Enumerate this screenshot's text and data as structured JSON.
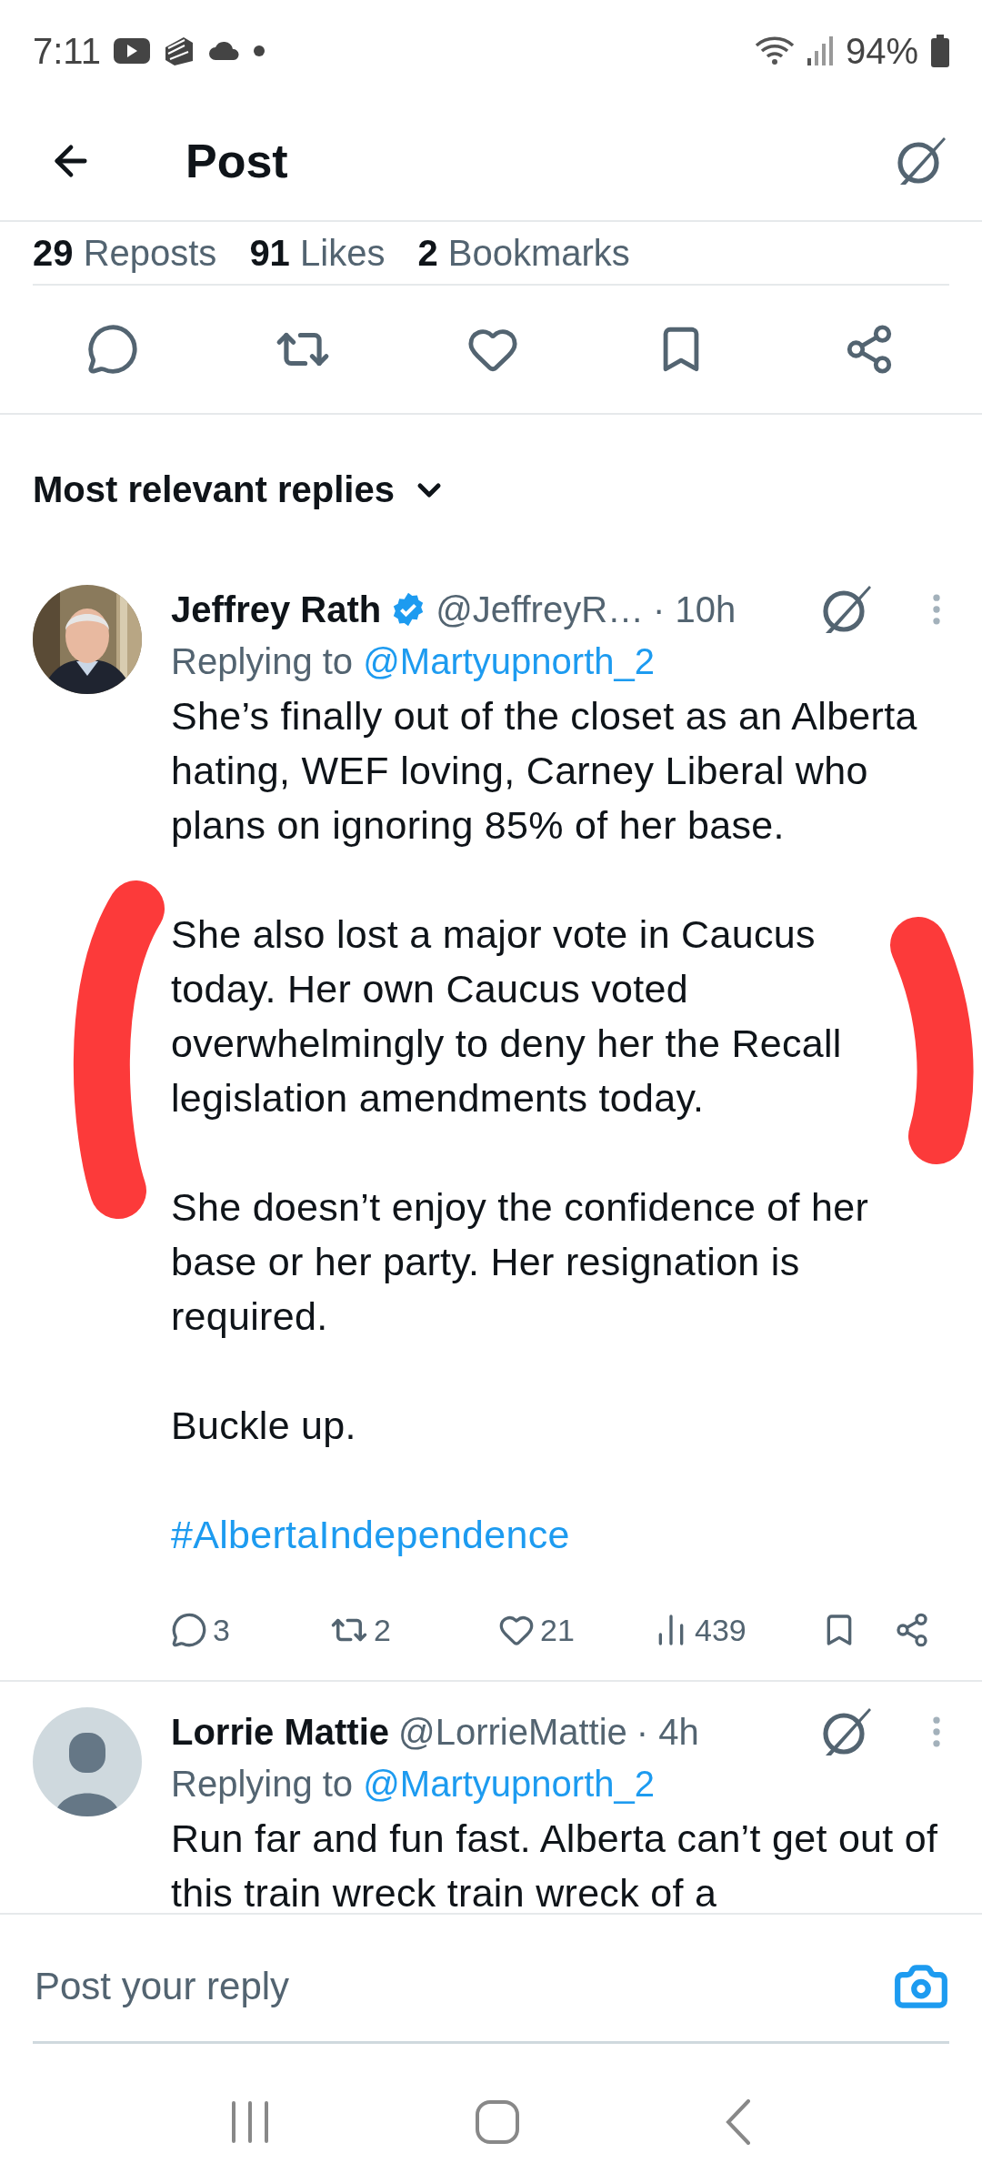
{
  "status_bar": {
    "time": "7:11",
    "battery": "94%"
  },
  "header": {
    "title": "Post"
  },
  "post_stats": [
    {
      "count": "29",
      "label": "Reposts"
    },
    {
      "count": "91",
      "label": "Likes"
    },
    {
      "count": "2",
      "label": "Bookmarks"
    }
  ],
  "replies_filter": {
    "label": "Most relevant replies"
  },
  "replies": [
    {
      "name": "Jeffrey Rath",
      "verified": true,
      "handle": "@JeffreyR…",
      "time": "· 10h",
      "replying_label": "Replying to",
      "replying_to": "@Martyupnorth_2",
      "paragraphs": [
        {
          "kind": "text",
          "text": "She’s finally out of the closet as an Alberta hating, WEF loving, Carney Liberal who plans on ignoring 85% of her base."
        },
        {
          "kind": "text",
          "text": "She also lost a major vote in Caucus today. Her own Caucus voted overwhelmingly to deny her the Recall legislation amendments today."
        },
        {
          "kind": "text",
          "text": "She doesn’t enjoy the confidence of her base or her party. Her resignation is required."
        },
        {
          "kind": "text",
          "text": "Buckle up."
        },
        {
          "kind": "hashtag",
          "text": "#AlbertaIndependence"
        }
      ],
      "stats": {
        "replies": "3",
        "reposts": "2",
        "likes": "21",
        "views": "439"
      }
    },
    {
      "name": "Lorrie Mattie",
      "verified": false,
      "handle": "@LorrieMattie",
      "time": "· 4h",
      "avatar": {
        "kind": "silhouette"
      },
      "replying_label": "Replying to",
      "replying_to": "@Martyupnorth_2",
      "paragraphs": [
        {
          "kind": "text",
          "text": "Run far and fun fast. Alberta can’t get out of this train wreck train wreck of a"
        }
      ]
    }
  ],
  "annotations": [
    {
      "kind": "stroke"
    },
    {
      "kind": "stroke"
    }
  ],
  "composer": {
    "placeholder": "Post your reply"
  }
}
